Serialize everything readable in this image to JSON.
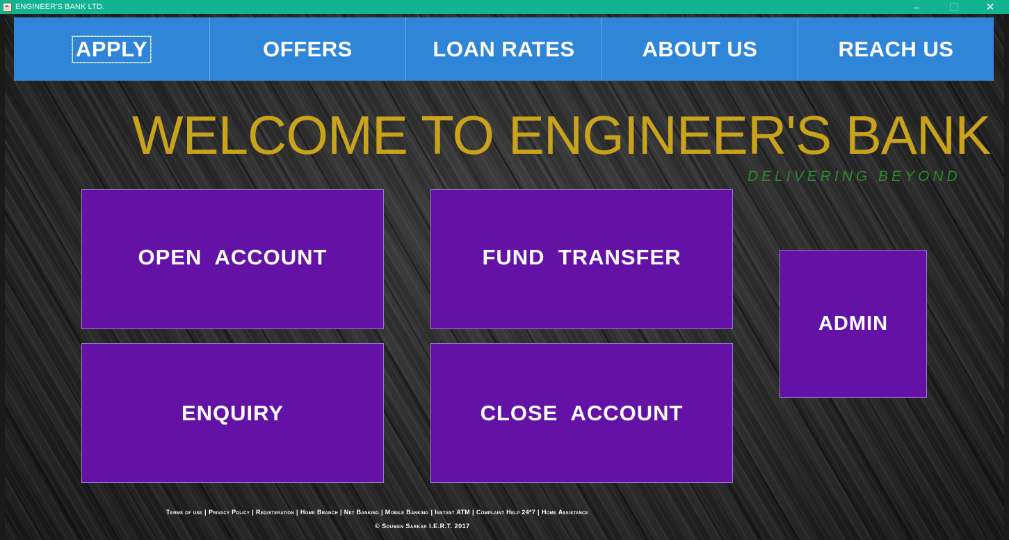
{
  "window": {
    "title": "ENGINEER'S BANK LTD.",
    "icon": "java-app-icon",
    "controls": {
      "minimize": "–",
      "close": "✕"
    }
  },
  "nav": {
    "items": [
      {
        "label": "APPLY"
      },
      {
        "label": "OFFERS"
      },
      {
        "label": "LOAN RATES"
      },
      {
        "label": "ABOUT US"
      },
      {
        "label": "REACH US"
      }
    ],
    "color": "#2f86d8"
  },
  "hero": {
    "title": "WELCOME TO ENGINEER'S BANK",
    "tagline": "DELIVERING BEYOND",
    "title_color": "#c9a31c",
    "tagline_color": "#2c8a2c"
  },
  "tiles": {
    "open_account": "OPEN  ACCOUNT",
    "fund_transfer": "FUND  TRANSFER",
    "enquiry": "ENQUIRY",
    "close_account": "CLOSE  ACCOUNT",
    "admin": "ADMIN",
    "color": "#6412a6"
  },
  "footer": {
    "links": [
      "Terms of use",
      "Privacy Policy",
      "Registeration",
      "Home Branch",
      "Net Banking",
      "Mobile Banking",
      "Instant ATM",
      "Complaint Help 24*7",
      "Home Assistance"
    ],
    "separator": "|",
    "copyright": "© Soumen Sarkar  I.E.R.T. 2017"
  }
}
